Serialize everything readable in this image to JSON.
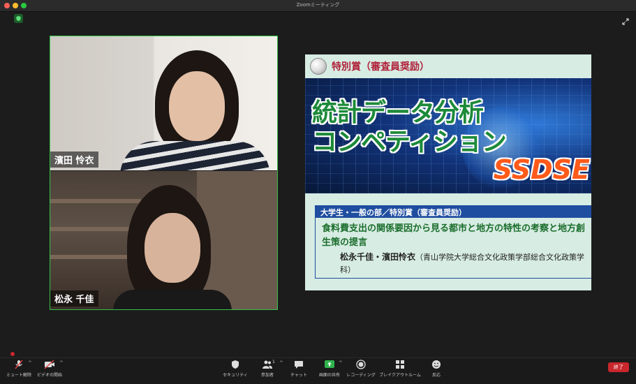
{
  "window": {
    "title": "Zoomミーティング"
  },
  "participants": [
    {
      "name": "濱田 怜衣"
    },
    {
      "name": "松永 千佳"
    }
  ],
  "slide": {
    "award_title": "特別賞（審査員奨励）",
    "banner_line1": "統計データ分析",
    "banner_line2": "コンペティション",
    "banner_logo": "SSDSE",
    "category": "大学生・一般の部／特別賞（審査員奨励）",
    "paper_title": "食料費支出の関係要因から見る都市と地方の特性の考察と地方創生策の提言",
    "authors_names": "松永千佳・濱田怜衣",
    "authors_affiliation": "（青山学院大学総合文化政策学部総合文化政策学科）"
  },
  "toolbar": {
    "mute": "ミュート解除",
    "video": "ビデオの開始",
    "security": "セキュリティ",
    "participants": "参加者",
    "participants_count": "1",
    "chat": "チャット",
    "share": "画面の共有",
    "record": "レコーディング",
    "breakout": "ブレイクアウトルーム",
    "reactions": "反応",
    "end": "終了"
  },
  "colors": {
    "active_speaker_border": "#35c04a",
    "share_icon": "#2fb34d",
    "end_button": "#c8272d",
    "award_title": "#b0213a",
    "paper_title": "#1b6e2c",
    "category_bar": "#1f4ea0",
    "logo": "#ff5a1a"
  }
}
